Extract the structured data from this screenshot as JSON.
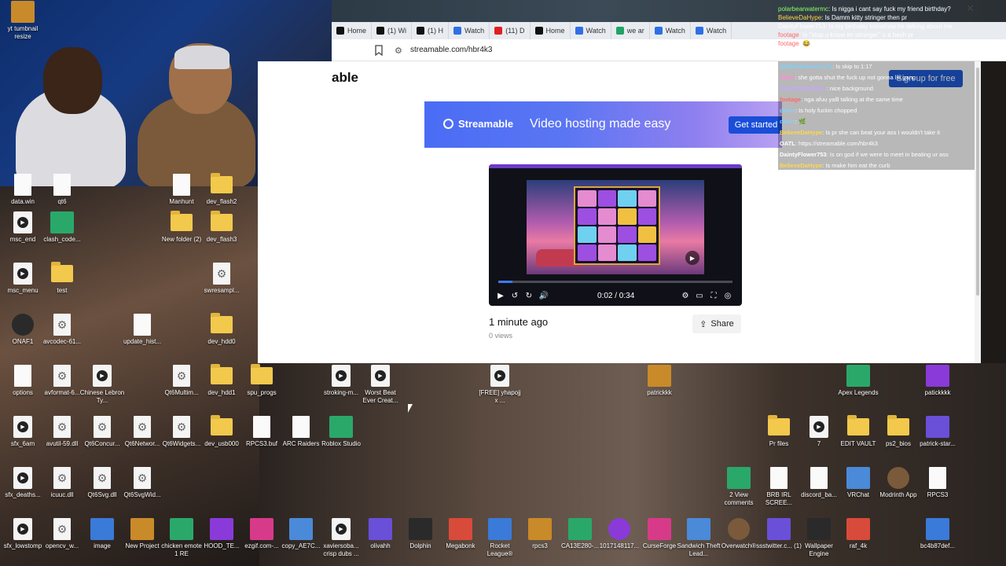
{
  "browser": {
    "tabs": [
      {
        "label": "Home",
        "icon": "x-icon",
        "color": "#111111"
      },
      {
        "label": "(1) Wi",
        "icon": "x-icon",
        "color": "#111111"
      },
      {
        "label": "(1) H",
        "icon": "x-icon",
        "color": "#111111"
      },
      {
        "label": "Watch",
        "icon": "streamable-icon",
        "color": "#2f6fe4"
      },
      {
        "label": "(11) D",
        "icon": "youtube-icon",
        "color": "#e02020"
      },
      {
        "label": "Home",
        "icon": "x-icon",
        "color": "#111111"
      },
      {
        "label": "Watch",
        "icon": "streamable-icon",
        "color": "#2f6fe4"
      },
      {
        "label": "we ar",
        "icon": "sheet-icon",
        "color": "#1fa463"
      },
      {
        "label": "Watch",
        "icon": "streamable-icon",
        "color": "#2f6fe4"
      },
      {
        "label": "Watch",
        "icon": "streamable-icon",
        "color": "#2f6fe4"
      }
    ],
    "close_glyph": "✕",
    "url": "streamable.com/hbr4k3"
  },
  "page": {
    "partial_title": "able",
    "signup_label": "Sign up for free",
    "banner": {
      "brand": "Streamable",
      "tagline": "Video hosting made easy",
      "cta": "Get started"
    },
    "player": {
      "time": "0:02 / 0:34",
      "progress_fraction": 0.059
    },
    "uploaded": "1 minute ago",
    "views": "0 views",
    "share_label": "Share"
  },
  "chat_top": [
    {
      "user": "polarbearwatermc",
      "color": "#8cff66",
      "text": ": Is nigga i cant say fuck my friend birthday?"
    },
    {
      "user": "BelieveDaHype",
      "color": "#ffd84a",
      "text": ": Is Damm kitty stringer then pr"
    },
    {
      "user": "DaintyFlower753",
      "color": "#ffffff",
      "text": ": Is my birthday tomorrow he talking about me"
    },
    {
      "user": "footage",
      "color": "#ff6a6a",
      "text": ": Is \"stop u know im stronger\" u a bech pr"
    },
    {
      "user": "footage",
      "color": "#ff6a6a",
      "text": ": 😂"
    }
  ],
  "chat": [
    {
      "user": "0p0bladedonkey71",
      "color": "#7ad3ff",
      "text": ": Is skip to 1:17"
    },
    {
      "user": "vibes",
      "color": "#ff8ad8",
      "text": ": she gotta shut the fuck up not gonna lie gang"
    },
    {
      "user": "GodFatheWalton",
      "color": "#c6a6ff",
      "text": ": nice background"
    },
    {
      "user": "footage",
      "color": "#ff6a6a",
      "text": ": nga afuu yalll talking at the same time"
    },
    {
      "user": "dilver",
      "color": "#8ad0ff",
      "text": ": Is holy fuckin chopped"
    },
    {
      "user": "dilver",
      "color": "#8ad0ff",
      "text": ": 🌿"
    },
    {
      "user": "BelieveDaHype",
      "color": "#ffd84a",
      "text": ": Is pr she can beat your ass I wouldn't take it"
    },
    {
      "user": "OATL",
      "color": "#ffffff",
      "text": ": https://streamable.com/hbr4k3"
    },
    {
      "user": "DaintyFlower753",
      "color": "#ffffff",
      "text": ": Is on god if we were to meet in beating ur ass"
    },
    {
      "user": "BelieveDaHype",
      "color": "#ffd84a",
      "text": ": Is make him eat the curb"
    }
  ],
  "desktop": {
    "icons": [
      {
        "label": "data.win",
        "kind": "file"
      },
      {
        "label": "qt6",
        "kind": "file"
      },
      {
        "label": "Manhunt",
        "kind": "file"
      },
      {
        "label": "dev_flash2",
        "kind": "folder"
      },
      {
        "label": "msc_end",
        "kind": "media"
      },
      {
        "label": "clash_code...",
        "kind": "tile"
      },
      {
        "label": "New folder (2)",
        "kind": "folder"
      },
      {
        "label": "dev_flash3",
        "kind": "folder"
      },
      {
        "label": "msc_menu",
        "kind": "media"
      },
      {
        "label": "test",
        "kind": "folder"
      },
      {
        "label": "swresampl...",
        "kind": "gear"
      },
      {
        "label": "ONAF1",
        "kind": "round"
      },
      {
        "label": "avcodec-61...",
        "kind": "gear"
      },
      {
        "label": "update_hist...",
        "kind": "file"
      },
      {
        "label": "dev_hdd0",
        "kind": "folder"
      },
      {
        "label": "options",
        "kind": "file"
      },
      {
        "label": "avformat-6...",
        "kind": "gear"
      },
      {
        "label": "Chinese Lebron Ty...",
        "kind": "media"
      },
      {
        "label": "Qt6Multim...",
        "kind": "gear"
      },
      {
        "label": "dev_hdd1",
        "kind": "folder"
      },
      {
        "label": "spu_progs",
        "kind": "folder"
      },
      {
        "label": "stroking-m...",
        "kind": "media"
      },
      {
        "label": "Worst Beat Ever Creat...",
        "kind": "media"
      },
      {
        "label": "[FREE] yhapojj x ...",
        "kind": "media"
      },
      {
        "label": "patrickkk",
        "kind": "tile"
      },
      {
        "label": "Apex Legends",
        "kind": "tile"
      },
      {
        "label": "patickkkk",
        "kind": "tile"
      },
      {
        "label": "sfx_6am",
        "kind": "media"
      },
      {
        "label": "avutil-59.dll",
        "kind": "gear"
      },
      {
        "label": "Qt6Concur...",
        "kind": "gear"
      },
      {
        "label": "Qt6Networ...",
        "kind": "gear"
      },
      {
        "label": "Qt6Widgets...",
        "kind": "gear"
      },
      {
        "label": "dev_usb000",
        "kind": "folder"
      },
      {
        "label": "RPCS3.buf",
        "kind": "file"
      },
      {
        "label": "ARC Raiders",
        "kind": "file"
      },
      {
        "label": "Roblox Studio",
        "kind": "tile"
      },
      {
        "label": "Pr files",
        "kind": "folder"
      },
      {
        "label": "7",
        "kind": "media"
      },
      {
        "label": "EDIT VAULT",
        "kind": "folder"
      },
      {
        "label": "ps2_bios",
        "kind": "folder"
      },
      {
        "label": "patrick-star...",
        "kind": "tile"
      },
      {
        "label": "sfx_deaths...",
        "kind": "media"
      },
      {
        "label": "icuuc.dll",
        "kind": "gear"
      },
      {
        "label": "Qt6Svg.dll",
        "kind": "gear"
      },
      {
        "label": "Qt6SvgWid...",
        "kind": "gear"
      },
      {
        "label": "2 View comments",
        "kind": "tile"
      },
      {
        "label": "BRB IRL SCREE...",
        "kind": "file"
      },
      {
        "label": "discord_ba...",
        "kind": "file"
      },
      {
        "label": "VRChat",
        "kind": "tile"
      },
      {
        "label": "Modrinth App",
        "kind": "round"
      },
      {
        "label": "RPCS3",
        "kind": "file"
      },
      {
        "label": "sfx_lowstomp",
        "kind": "media"
      },
      {
        "label": "opencv_w...",
        "kind": "gear"
      },
      {
        "label": "image",
        "kind": "tile"
      },
      {
        "label": "New Project",
        "kind": "tile"
      },
      {
        "label": "chicken emote 1 RE",
        "kind": "tile"
      },
      {
        "label": "HOOD_TE...",
        "kind": "tile"
      },
      {
        "label": "ezgif.com-...",
        "kind": "tile"
      },
      {
        "label": "copy_AE7C...",
        "kind": "tile"
      },
      {
        "label": "xaviersoba... crisp dubs ...",
        "kind": "media"
      },
      {
        "label": "olivahh",
        "kind": "tile"
      },
      {
        "label": "Dolphin",
        "kind": "tile"
      },
      {
        "label": "Megabonk",
        "kind": "tile"
      },
      {
        "label": "Rocket League®",
        "kind": "tile"
      },
      {
        "label": "rpcs3",
        "kind": "tile"
      },
      {
        "label": "CA13E280-...",
        "kind": "tile"
      },
      {
        "label": "1017148117...",
        "kind": "round"
      },
      {
        "label": "CurseForge",
        "kind": "tile"
      },
      {
        "label": "Sandwich Theft Lead...",
        "kind": "tile"
      },
      {
        "label": "Overwatch®",
        "kind": "round"
      },
      {
        "label": "ssstwitter.c... (1)",
        "kind": "tile"
      },
      {
        "label": "Wallpaper Engine",
        "kind": "tile"
      },
      {
        "label": "raf_4k",
        "kind": "tile"
      },
      {
        "label": "bc4b87def...",
        "kind": "tile"
      },
      {
        "label": "yt tumbnail resize",
        "kind": "tile"
      }
    ]
  },
  "colors": {
    "streamable_blue": "#1e5bd6",
    "progress": "#3c7bf4"
  }
}
